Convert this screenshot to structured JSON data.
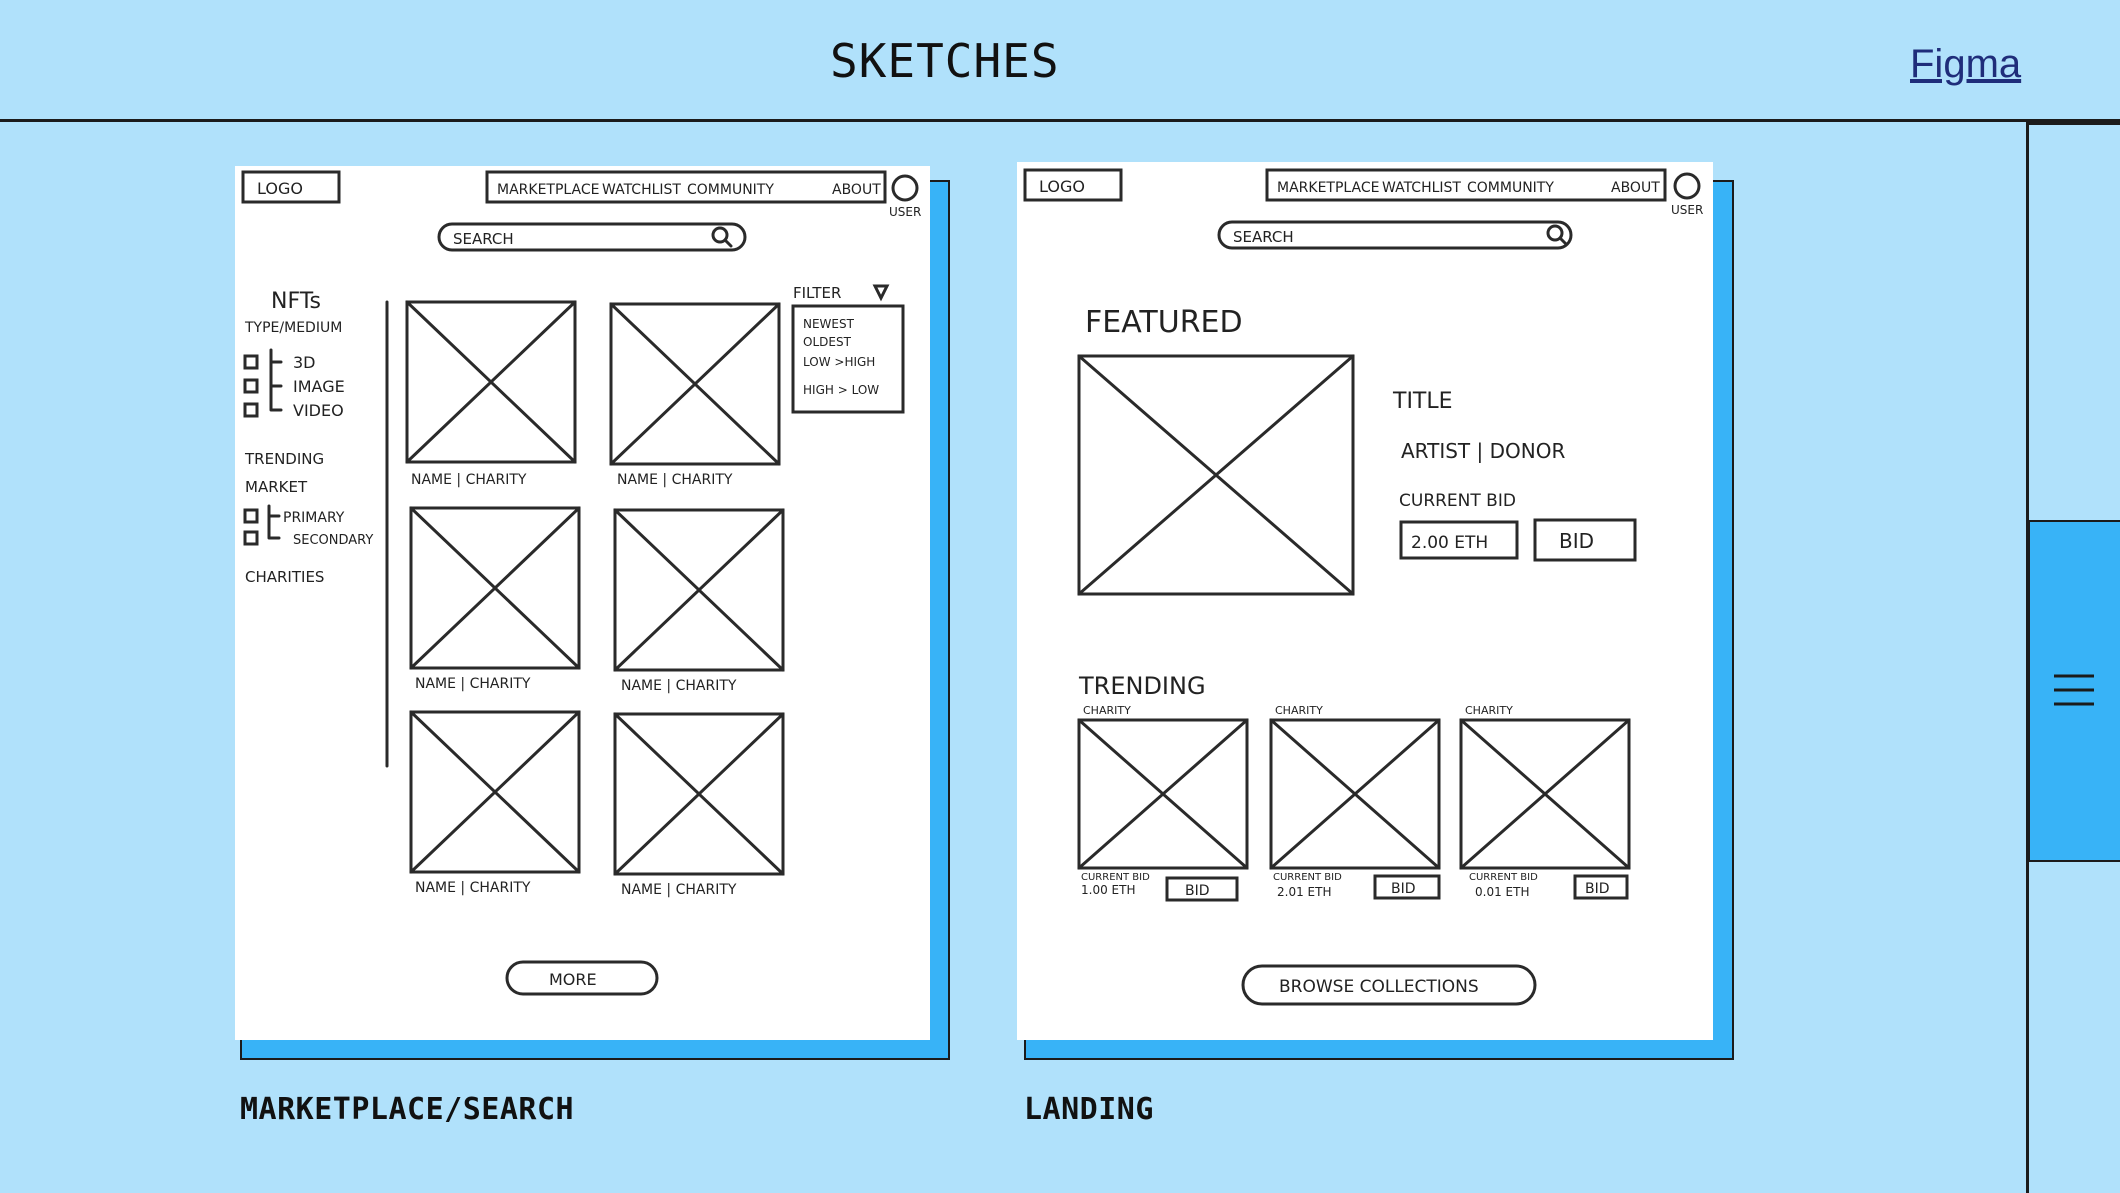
{
  "header": {
    "title": "SKETCHES",
    "figma_link": "Figma"
  },
  "sketches": [
    {
      "caption": "MARKETPLACE/SEARCH",
      "nav": {
        "logo": "LOGO",
        "links": [
          "MARKETPLACE",
          "WATCHLIST",
          "COMMUNITY",
          "ABOUT"
        ],
        "user": "USER"
      },
      "search_placeholder": "SEARCH",
      "sidebar": {
        "title": "NFTs",
        "type_label": "TYPE/MEDIUM",
        "type_options": [
          "3D",
          "IMAGE",
          "VIDEO"
        ],
        "trending_label": "TRENDING",
        "market_label": "MARKET",
        "market_options": [
          "PRIMARY",
          "SECONDARY"
        ],
        "charities_label": "CHARITIES"
      },
      "filter": {
        "label": "FILTER",
        "options": [
          "NEWEST",
          "OLDEST",
          "LOW >HIGH",
          "HIGH > LOW"
        ]
      },
      "tile_caption": "NAME  | CHARITY",
      "more_button": "MORE"
    },
    {
      "caption": "LANDING",
      "nav": {
        "logo": "LOGO",
        "links": [
          "MARKETPLACE",
          "WATCHLIST",
          "COMMUNITY",
          "ABOUT"
        ],
        "user": "USER"
      },
      "search_placeholder": "SEARCH",
      "featured": {
        "heading": "FEATURED",
        "title": "TITLE",
        "artist_donor": "ARTIST | DONOR",
        "current_bid_label": "CURRENT BID",
        "price": "2.00 ETH",
        "bid_button": "BID"
      },
      "trending": {
        "heading": "TRENDING",
        "items": [
          {
            "charity": "CHARITY",
            "bid_label": "CURRENT BID",
            "price": "1.00 ETH",
            "bid_button": "BID"
          },
          {
            "charity": "CHARITY",
            "bid_label": "CURRENT BID",
            "price": "2.01 ETH",
            "bid_button": "BID"
          },
          {
            "charity": "CHARITY",
            "bid_label": "CURRENT BID",
            "price": "0.01 ETH",
            "bid_button": "BID"
          }
        ]
      },
      "browse_button": "BROWSE COLLECTIONS"
    }
  ],
  "colors": {
    "background": "#b0e1fb",
    "accent": "#38b3f7",
    "ink": "#1b1b1b"
  },
  "icons": {
    "menu": "hamburger-menu-icon",
    "search": "search-icon",
    "user": "user-icon",
    "filter": "filter-icon"
  }
}
